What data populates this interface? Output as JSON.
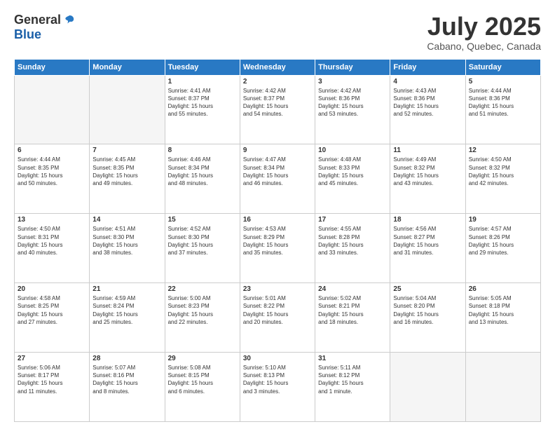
{
  "header": {
    "logo_general": "General",
    "logo_blue": "Blue",
    "month_title": "July 2025",
    "location": "Cabano, Quebec, Canada"
  },
  "weekdays": [
    "Sunday",
    "Monday",
    "Tuesday",
    "Wednesday",
    "Thursday",
    "Friday",
    "Saturday"
  ],
  "weeks": [
    [
      {
        "day": "",
        "info": ""
      },
      {
        "day": "",
        "info": ""
      },
      {
        "day": "1",
        "info": "Sunrise: 4:41 AM\nSunset: 8:37 PM\nDaylight: 15 hours\nand 55 minutes."
      },
      {
        "day": "2",
        "info": "Sunrise: 4:42 AM\nSunset: 8:37 PM\nDaylight: 15 hours\nand 54 minutes."
      },
      {
        "day": "3",
        "info": "Sunrise: 4:42 AM\nSunset: 8:36 PM\nDaylight: 15 hours\nand 53 minutes."
      },
      {
        "day": "4",
        "info": "Sunrise: 4:43 AM\nSunset: 8:36 PM\nDaylight: 15 hours\nand 52 minutes."
      },
      {
        "day": "5",
        "info": "Sunrise: 4:44 AM\nSunset: 8:36 PM\nDaylight: 15 hours\nand 51 minutes."
      }
    ],
    [
      {
        "day": "6",
        "info": "Sunrise: 4:44 AM\nSunset: 8:35 PM\nDaylight: 15 hours\nand 50 minutes."
      },
      {
        "day": "7",
        "info": "Sunrise: 4:45 AM\nSunset: 8:35 PM\nDaylight: 15 hours\nand 49 minutes."
      },
      {
        "day": "8",
        "info": "Sunrise: 4:46 AM\nSunset: 8:34 PM\nDaylight: 15 hours\nand 48 minutes."
      },
      {
        "day": "9",
        "info": "Sunrise: 4:47 AM\nSunset: 8:34 PM\nDaylight: 15 hours\nand 46 minutes."
      },
      {
        "day": "10",
        "info": "Sunrise: 4:48 AM\nSunset: 8:33 PM\nDaylight: 15 hours\nand 45 minutes."
      },
      {
        "day": "11",
        "info": "Sunrise: 4:49 AM\nSunset: 8:32 PM\nDaylight: 15 hours\nand 43 minutes."
      },
      {
        "day": "12",
        "info": "Sunrise: 4:50 AM\nSunset: 8:32 PM\nDaylight: 15 hours\nand 42 minutes."
      }
    ],
    [
      {
        "day": "13",
        "info": "Sunrise: 4:50 AM\nSunset: 8:31 PM\nDaylight: 15 hours\nand 40 minutes."
      },
      {
        "day": "14",
        "info": "Sunrise: 4:51 AM\nSunset: 8:30 PM\nDaylight: 15 hours\nand 38 minutes."
      },
      {
        "day": "15",
        "info": "Sunrise: 4:52 AM\nSunset: 8:30 PM\nDaylight: 15 hours\nand 37 minutes."
      },
      {
        "day": "16",
        "info": "Sunrise: 4:53 AM\nSunset: 8:29 PM\nDaylight: 15 hours\nand 35 minutes."
      },
      {
        "day": "17",
        "info": "Sunrise: 4:55 AM\nSunset: 8:28 PM\nDaylight: 15 hours\nand 33 minutes."
      },
      {
        "day": "18",
        "info": "Sunrise: 4:56 AM\nSunset: 8:27 PM\nDaylight: 15 hours\nand 31 minutes."
      },
      {
        "day": "19",
        "info": "Sunrise: 4:57 AM\nSunset: 8:26 PM\nDaylight: 15 hours\nand 29 minutes."
      }
    ],
    [
      {
        "day": "20",
        "info": "Sunrise: 4:58 AM\nSunset: 8:25 PM\nDaylight: 15 hours\nand 27 minutes."
      },
      {
        "day": "21",
        "info": "Sunrise: 4:59 AM\nSunset: 8:24 PM\nDaylight: 15 hours\nand 25 minutes."
      },
      {
        "day": "22",
        "info": "Sunrise: 5:00 AM\nSunset: 8:23 PM\nDaylight: 15 hours\nand 22 minutes."
      },
      {
        "day": "23",
        "info": "Sunrise: 5:01 AM\nSunset: 8:22 PM\nDaylight: 15 hours\nand 20 minutes."
      },
      {
        "day": "24",
        "info": "Sunrise: 5:02 AM\nSunset: 8:21 PM\nDaylight: 15 hours\nand 18 minutes."
      },
      {
        "day": "25",
        "info": "Sunrise: 5:04 AM\nSunset: 8:20 PM\nDaylight: 15 hours\nand 16 minutes."
      },
      {
        "day": "26",
        "info": "Sunrise: 5:05 AM\nSunset: 8:18 PM\nDaylight: 15 hours\nand 13 minutes."
      }
    ],
    [
      {
        "day": "27",
        "info": "Sunrise: 5:06 AM\nSunset: 8:17 PM\nDaylight: 15 hours\nand 11 minutes."
      },
      {
        "day": "28",
        "info": "Sunrise: 5:07 AM\nSunset: 8:16 PM\nDaylight: 15 hours\nand 8 minutes."
      },
      {
        "day": "29",
        "info": "Sunrise: 5:08 AM\nSunset: 8:15 PM\nDaylight: 15 hours\nand 6 minutes."
      },
      {
        "day": "30",
        "info": "Sunrise: 5:10 AM\nSunset: 8:13 PM\nDaylight: 15 hours\nand 3 minutes."
      },
      {
        "day": "31",
        "info": "Sunrise: 5:11 AM\nSunset: 8:12 PM\nDaylight: 15 hours\nand 1 minute."
      },
      {
        "day": "",
        "info": ""
      },
      {
        "day": "",
        "info": ""
      }
    ]
  ]
}
